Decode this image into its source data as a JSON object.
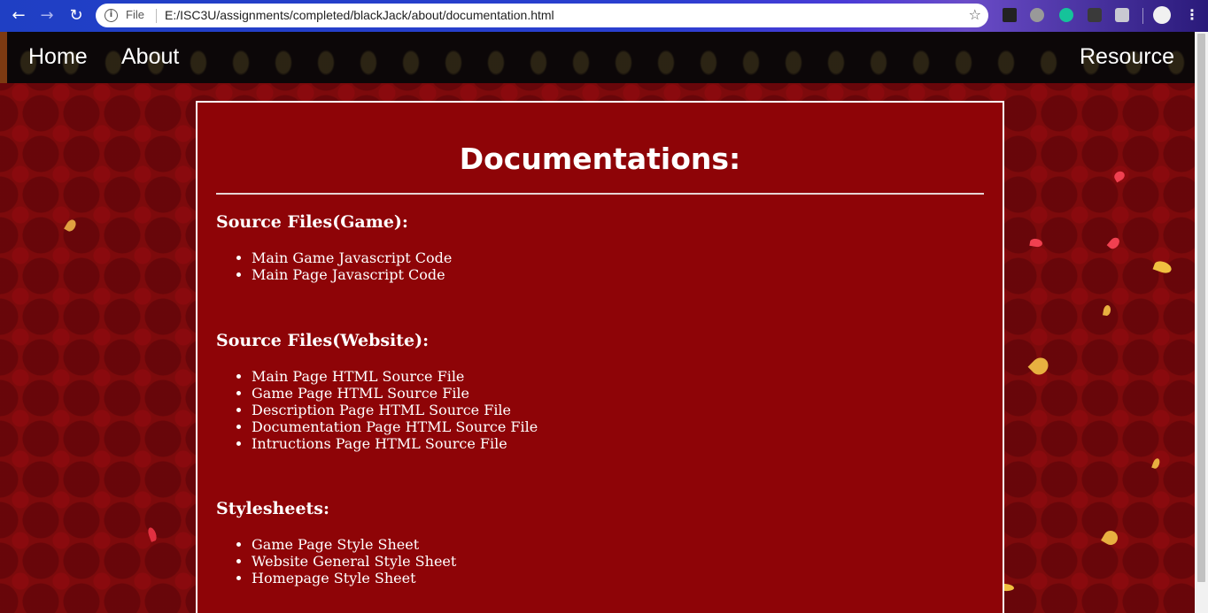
{
  "browser": {
    "scheme_label": "File",
    "url": "E:/ISC3U/assignments/completed/blackJack/about/documentation.html",
    "back_icon": "arrow-left-icon",
    "forward_icon": "arrow-right-icon",
    "reload_icon": "reload-icon"
  },
  "navbar": {
    "home": "Home",
    "about": "About",
    "resource": "Resource"
  },
  "page": {
    "title": "Documentations:",
    "sections": [
      {
        "heading": "Source Files(Game):",
        "items": [
          "Main Game Javascript Code",
          "Main Page Javascript Code"
        ]
      },
      {
        "heading": "Source Files(Website):",
        "items": [
          "Main Page HTML Source File",
          "Game Page HTML Source File",
          "Description Page HTML Source File",
          "Documentation Page HTML Source File",
          "Intructions Page HTML Source File"
        ]
      },
      {
        "heading": "Stylesheets:",
        "items": [
          "Game Page Style Sheet",
          "Website General Style Sheet",
          "Homepage Style Sheet"
        ]
      }
    ]
  },
  "colors": {
    "background": "#7d0a0c",
    "card": "#8e0407",
    "navbar": "#0c0708",
    "text": "#ffffff"
  }
}
